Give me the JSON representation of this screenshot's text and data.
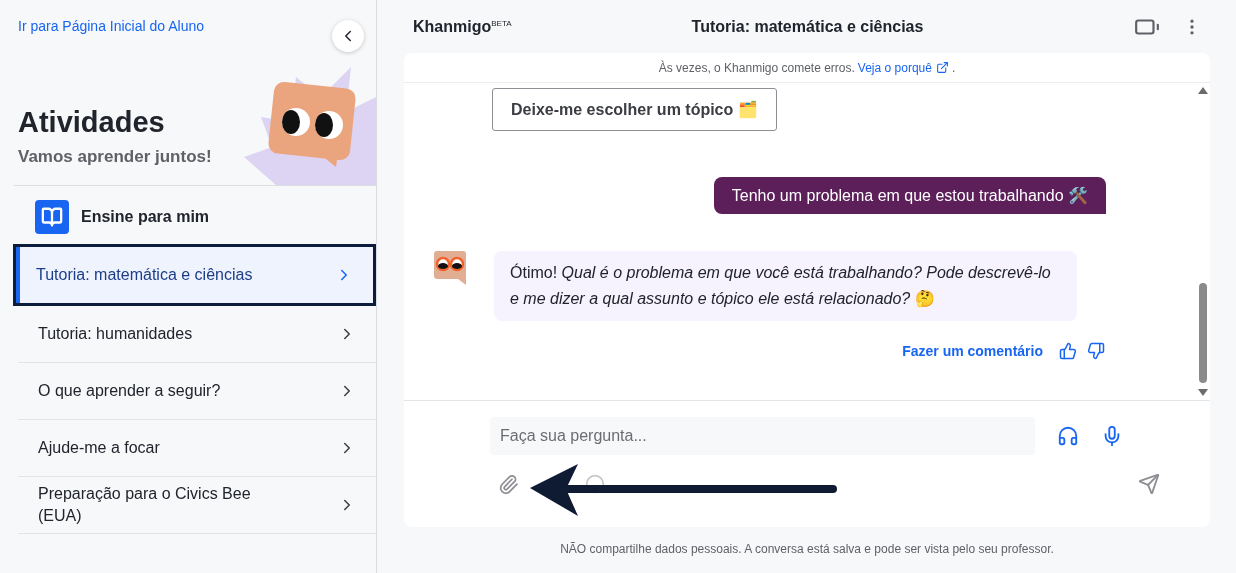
{
  "sidebar": {
    "home_link": "Ir para Página Inicial do Aluno",
    "title": "Atividades",
    "subtitle": "Vamos aprender juntos!",
    "section": "Ensine para mim",
    "items": [
      {
        "label": "Tutoria: matemática e ciências",
        "selected": true
      },
      {
        "label": "Tutoria: humanidades",
        "selected": false
      },
      {
        "label": "O que aprender a seguir?",
        "selected": false
      },
      {
        "label": "Ajude-me a focar",
        "selected": false
      },
      {
        "label": "Preparação para o Civics Bee (EUA)",
        "selected": false
      }
    ]
  },
  "header": {
    "brand": "Khanmigo",
    "badge": "BETA",
    "title": "Tutoria: matemática e ciências"
  },
  "notice": {
    "text": "Às vezes, o Khanmigo comete erros.",
    "link": "Veja o porquê",
    "end": "."
  },
  "messages": [
    {
      "kind": "option",
      "text": "Deixe-me escolher um tópico 🗂️"
    },
    {
      "kind": "user",
      "text": "Tenho um problema em que estou trabalhando 🛠️"
    },
    {
      "kind": "bot",
      "text": "Ótimo! *Qual é o problema em que você está trabalhando? Pode descrevê-lo e me dizer a qual assunto e tópico ele está relacionado?* 🤔"
    }
  ],
  "feedback": "Fazer um comentário",
  "composer": {
    "placeholder": "Faça sua pergunta..."
  },
  "footer": "NÃO compartilhe dados pessoais. A conversa está salva e pode ser vista pelo seu professor."
}
